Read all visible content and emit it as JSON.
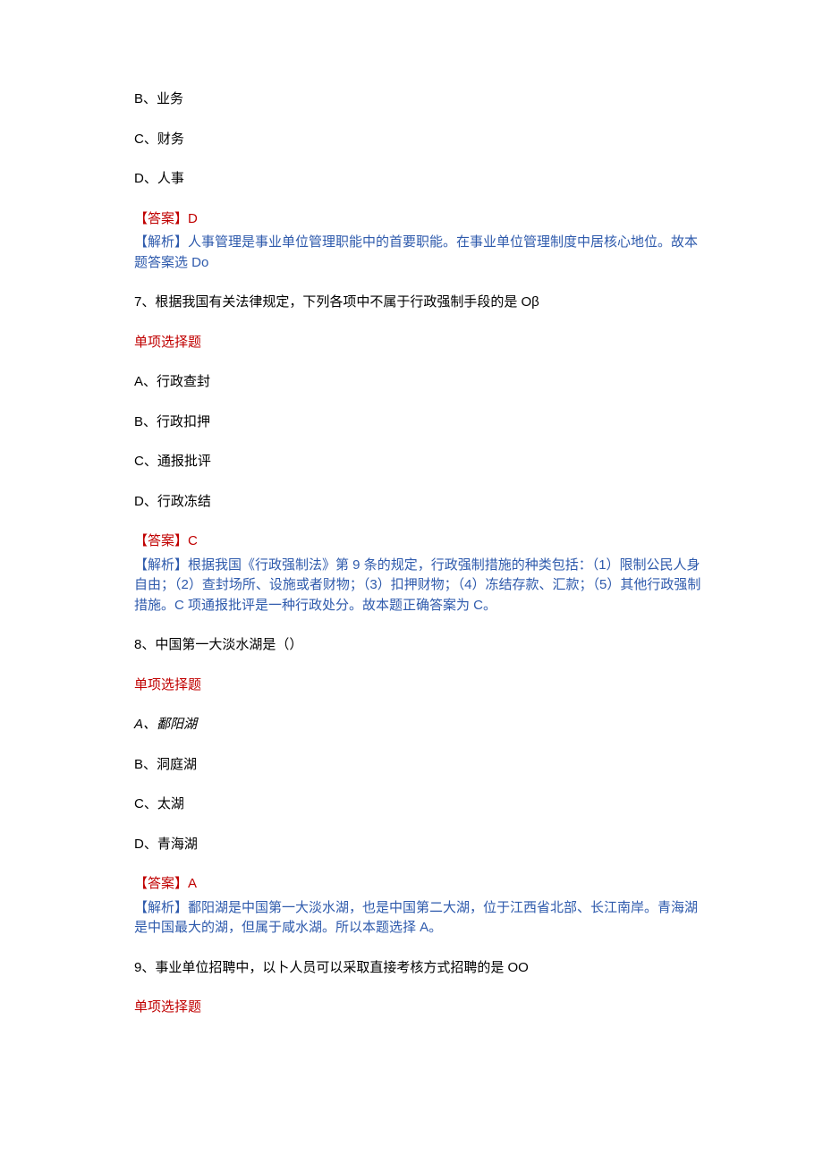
{
  "q6": {
    "optionB": "B、业务",
    "optionC": "C、财务",
    "optionD": "D、人事",
    "answerLabel": "【答案】",
    "answerVal": "D",
    "explainLabel": "【解析】",
    "explainText": "人事管理是事业单位管理职能中的首要职能。在事业单位管理制度中居核心地位。故本题答案选 Do"
  },
  "q7": {
    "stem": "7、根据我国有关法律规定，下列各项中不属于行政强制手段的是 Oβ",
    "typeLabel": "单项选择题",
    "optionA": "A、行政查封",
    "optionB": "B、行政扣押",
    "optionC": "C、通报批评",
    "optionD": "D、行政冻结",
    "answerLabel": "【答案】",
    "answerVal": "C",
    "explainLabel": "【解析】",
    "explainText": "根据我国《行政强制法》第 9 条的规定，行政强制措施的种类包括：（1）限制公民人身自由；（2）查封场所、设施或者财物；（3）扣押财物；（4）冻结存款、汇款；（5）其他行政强制措施。C 项通报批评是一种行政处分。故本题正确答案为 C。"
  },
  "q8": {
    "stem": "8、中国第一大淡水湖是（）",
    "typeLabel": "单项选择题",
    "optionA": "A、鄱阳湖",
    "optionB": "B、洞庭湖",
    "optionC": "C、太湖",
    "optionD": "D、青海湖",
    "answerLabel": "【答案】",
    "answerVal": "A",
    "explainLabel": "【解析】",
    "explainText": "鄱阳湖是中国第一大淡水湖，也是中国第二大湖，位于江西省北部、长江南岸。青海湖是中国最大的湖，但属于咸水湖。所以本题选择 A。"
  },
  "q9": {
    "stem": "9、事业单位招聘中，以卜人员可以采取直接考核方式招聘的是 OO",
    "typeLabel": "单项选择题"
  },
  "q8OptionAStyle": "italic"
}
